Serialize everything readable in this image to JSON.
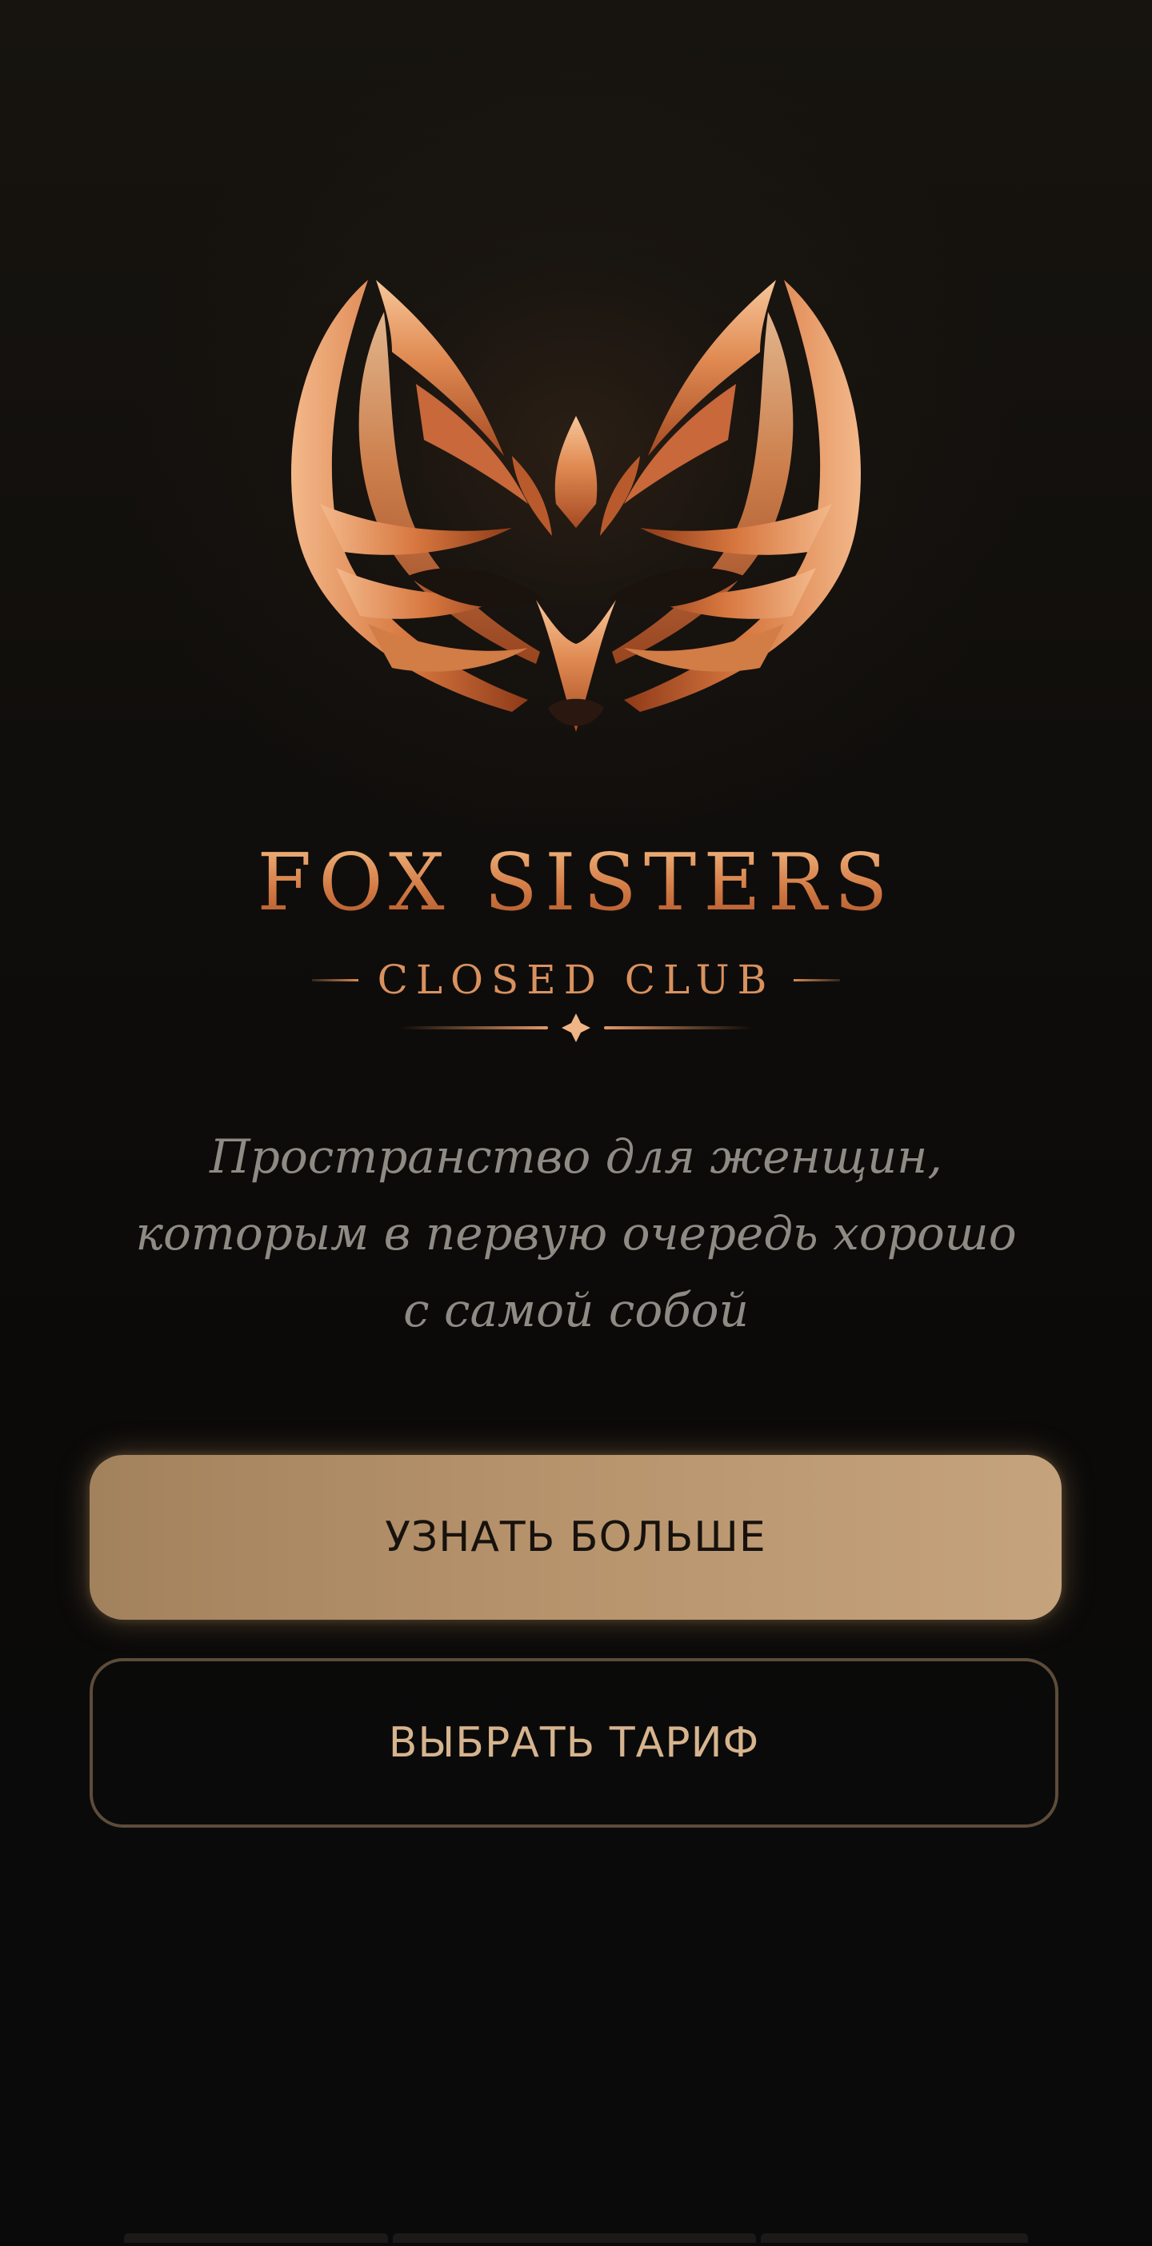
{
  "brand": {
    "title": "FOX SISTERS",
    "subtitle": "CLOSED CLUB",
    "logo_icon": "fox-mask-icon"
  },
  "tagline": {
    "lines": [
      "Пространство для женщин,",
      "которым в первую очередь хорошо",
      "с самой собой"
    ]
  },
  "actions": {
    "learn_more_label": "УЗНАТЬ БОЛЬШЕ",
    "choose_plan_label": "ВЫБРАТЬ ТАРИФ"
  },
  "colors": {
    "background": "#0b0a09",
    "accent_copper": "#d68a55",
    "primary_button": "#b8946d",
    "secondary_border": "#5d4c3a",
    "secondary_text": "#d6b48e",
    "tagline_text": "#8e8a84"
  }
}
